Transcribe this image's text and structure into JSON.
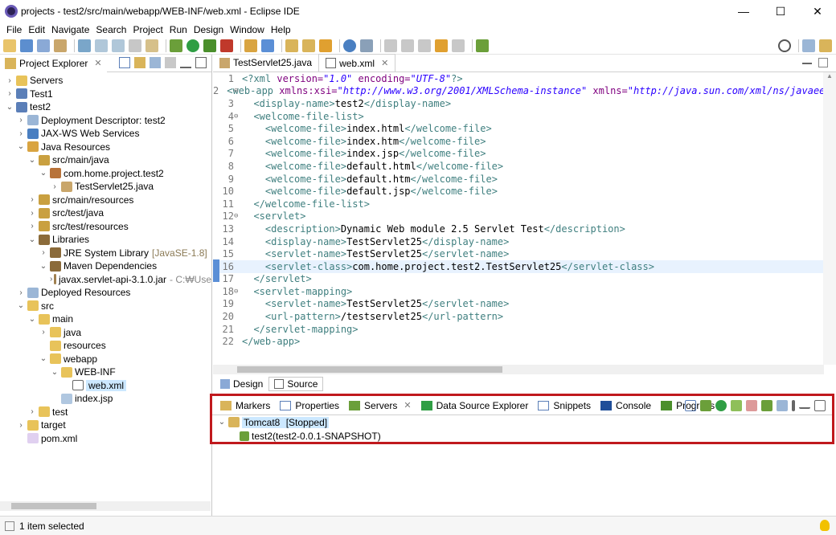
{
  "window": {
    "title": "projects - test2/src/main/webapp/WEB-INF/web.xml - Eclipse IDE",
    "minimize": "—",
    "maximize": "☐",
    "close": "✕"
  },
  "menu": [
    "File",
    "Edit",
    "Navigate",
    "Search",
    "Project",
    "Run",
    "Design",
    "Window",
    "Help"
  ],
  "project_explorer": {
    "tab_label": "Project Explorer",
    "tree": [
      {
        "indent": 0,
        "twisty": "›",
        "icon": "folder-icon",
        "label": "Servers"
      },
      {
        "indent": 0,
        "twisty": "›",
        "icon": "project-icon",
        "label": "Test1"
      },
      {
        "indent": 0,
        "twisty": "⌄",
        "icon": "project-icon",
        "label": "test2"
      },
      {
        "indent": 1,
        "twisty": "›",
        "icon": "deployment-descriptor-icon",
        "label": "Deployment Descriptor: test2"
      },
      {
        "indent": 1,
        "twisty": "›",
        "icon": "web-services-icon",
        "label": "JAX-WS Web Services"
      },
      {
        "indent": 1,
        "twisty": "⌄",
        "icon": "java-resources-icon",
        "label": "Java Resources"
      },
      {
        "indent": 2,
        "twisty": "⌄",
        "icon": "source-folder-icon",
        "label": "src/main/java"
      },
      {
        "indent": 3,
        "twisty": "⌄",
        "icon": "package-icon",
        "label": "com.home.project.test2"
      },
      {
        "indent": 4,
        "twisty": "›",
        "icon": "java-file-icon",
        "label": "TestServlet25.java"
      },
      {
        "indent": 2,
        "twisty": "›",
        "icon": "source-folder-icon",
        "label": "src/main/resources"
      },
      {
        "indent": 2,
        "twisty": "›",
        "icon": "source-folder-icon",
        "label": "src/test/java"
      },
      {
        "indent": 2,
        "twisty": "›",
        "icon": "source-folder-icon",
        "label": "src/test/resources"
      },
      {
        "indent": 2,
        "twisty": "⌄",
        "icon": "libraries-icon",
        "label": "Libraries"
      },
      {
        "indent": 3,
        "twisty": "›",
        "icon": "library-icon",
        "label": "JRE System Library",
        "suffix": "[JavaSE-1.8]"
      },
      {
        "indent": 3,
        "twisty": "⌄",
        "icon": "library-icon",
        "label": "Maven Dependencies"
      },
      {
        "indent": 4,
        "twisty": "›",
        "icon": "jar-icon",
        "label": "javax.servlet-api-3.1.0.jar",
        "suffix2": "- C:₩Use"
      },
      {
        "indent": 1,
        "twisty": "›",
        "icon": "deployed-resources-icon",
        "label": "Deployed Resources"
      },
      {
        "indent": 1,
        "twisty": "⌄",
        "icon": "folder-icon",
        "label": "src"
      },
      {
        "indent": 2,
        "twisty": "⌄",
        "icon": "folder-icon",
        "label": "main"
      },
      {
        "indent": 3,
        "twisty": "›",
        "icon": "folder-icon",
        "label": "java"
      },
      {
        "indent": 3,
        "twisty": "",
        "icon": "folder-icon",
        "label": "resources"
      },
      {
        "indent": 3,
        "twisty": "⌄",
        "icon": "folder-icon",
        "label": "webapp"
      },
      {
        "indent": 4,
        "twisty": "⌄",
        "icon": "folder-icon",
        "label": "WEB-INF"
      },
      {
        "indent": 5,
        "twisty": "",
        "icon": "xml-file-icon",
        "label": "web.xml",
        "selected": true
      },
      {
        "indent": 4,
        "twisty": "",
        "icon": "jsp-file-icon",
        "label": "index.jsp"
      },
      {
        "indent": 2,
        "twisty": "›",
        "icon": "folder-icon",
        "label": "test"
      },
      {
        "indent": 1,
        "twisty": "›",
        "icon": "folder-icon",
        "label": "target"
      },
      {
        "indent": 1,
        "twisty": "",
        "icon": "pom-file-icon",
        "label": "pom.xml"
      }
    ]
  },
  "editor": {
    "tabs": [
      {
        "label": "TestServlet25.java",
        "icon": "java-file-icon",
        "active": false
      },
      {
        "label": "web.xml",
        "icon": "xml-file-icon",
        "active": true
      }
    ],
    "lines": [
      {
        "n": "1",
        "fold": "",
        "parts": [
          [
            "pi",
            "<?xml "
          ],
          [
            "attr",
            "version="
          ],
          [
            "str",
            "\"1.0\""
          ],
          [
            "attr",
            " encoding="
          ],
          [
            "str",
            "\"UTF-8\""
          ],
          [
            "pi",
            "?>"
          ]
        ]
      },
      {
        "n": "2",
        "fold": "⊖",
        "parts": [
          [
            "tag",
            "<web-app "
          ],
          [
            "attr",
            "xmlns:xsi="
          ],
          [
            "str",
            "\"http://www.w3.org/2001/XMLSchema-instance\""
          ],
          [
            "attr",
            " xmlns="
          ],
          [
            "str",
            "\"http://java.sun.com/xml/ns/javaee\""
          ]
        ]
      },
      {
        "n": "3",
        "fold": "",
        "parts": [
          [
            "txt",
            "  "
          ],
          [
            "tag",
            "<display-name>"
          ],
          [
            "txt",
            "test2"
          ],
          [
            "tag",
            "</display-name>"
          ]
        ]
      },
      {
        "n": "4",
        "fold": "⊖",
        "parts": [
          [
            "txt",
            "  "
          ],
          [
            "tag",
            "<welcome-file-list>"
          ]
        ]
      },
      {
        "n": "5",
        "fold": "",
        "parts": [
          [
            "txt",
            "    "
          ],
          [
            "tag",
            "<welcome-file>"
          ],
          [
            "txt",
            "index.html"
          ],
          [
            "tag",
            "</welcome-file>"
          ]
        ]
      },
      {
        "n": "6",
        "fold": "",
        "parts": [
          [
            "txt",
            "    "
          ],
          [
            "tag",
            "<welcome-file>"
          ],
          [
            "txt",
            "index.htm"
          ],
          [
            "tag",
            "</welcome-file>"
          ]
        ]
      },
      {
        "n": "7",
        "fold": "",
        "parts": [
          [
            "txt",
            "    "
          ],
          [
            "tag",
            "<welcome-file>"
          ],
          [
            "txt",
            "index.jsp"
          ],
          [
            "tag",
            "</welcome-file>"
          ]
        ]
      },
      {
        "n": "8",
        "fold": "",
        "parts": [
          [
            "txt",
            "    "
          ],
          [
            "tag",
            "<welcome-file>"
          ],
          [
            "txt",
            "default.html"
          ],
          [
            "tag",
            "</welcome-file>"
          ]
        ]
      },
      {
        "n": "9",
        "fold": "",
        "parts": [
          [
            "txt",
            "    "
          ],
          [
            "tag",
            "<welcome-file>"
          ],
          [
            "txt",
            "default.htm"
          ],
          [
            "tag",
            "</welcome-file>"
          ]
        ]
      },
      {
        "n": "10",
        "fold": "",
        "parts": [
          [
            "txt",
            "    "
          ],
          [
            "tag",
            "<welcome-file>"
          ],
          [
            "txt",
            "default.jsp"
          ],
          [
            "tag",
            "</welcome-file>"
          ]
        ]
      },
      {
        "n": "11",
        "fold": "",
        "parts": [
          [
            "txt",
            "  "
          ],
          [
            "tag",
            "</welcome-file-list>"
          ]
        ]
      },
      {
        "n": "12",
        "fold": "⊖",
        "parts": [
          [
            "txt",
            "  "
          ],
          [
            "tag",
            "<servlet>"
          ]
        ]
      },
      {
        "n": "13",
        "fold": "",
        "parts": [
          [
            "txt",
            "    "
          ],
          [
            "tag",
            "<description>"
          ],
          [
            "txt",
            "Dynamic Web module 2.5 Servlet Test"
          ],
          [
            "tag",
            "</description>"
          ]
        ]
      },
      {
        "n": "14",
        "fold": "",
        "parts": [
          [
            "txt",
            "    "
          ],
          [
            "tag",
            "<display-name>"
          ],
          [
            "txt",
            "TestServlet25"
          ],
          [
            "tag",
            "</display-name>"
          ]
        ]
      },
      {
        "n": "15",
        "fold": "",
        "parts": [
          [
            "txt",
            "    "
          ],
          [
            "tag",
            "<servlet-name>"
          ],
          [
            "txt",
            "TestServlet25"
          ],
          [
            "tag",
            "</servlet-name>"
          ]
        ]
      },
      {
        "n": "16",
        "fold": "",
        "highlight": true,
        "parts": [
          [
            "txt",
            "    "
          ],
          [
            "tag",
            "<servlet-class>"
          ],
          [
            "txt",
            "com.home.project.test2.TestServlet25"
          ],
          [
            "tag",
            "</servlet-class>"
          ]
        ]
      },
      {
        "n": "17",
        "fold": "",
        "parts": [
          [
            "txt",
            "  "
          ],
          [
            "tag",
            "</servlet>"
          ]
        ]
      },
      {
        "n": "18",
        "fold": "⊖",
        "parts": [
          [
            "txt",
            "  "
          ],
          [
            "tag",
            "<servlet-mapping>"
          ]
        ]
      },
      {
        "n": "19",
        "fold": "",
        "parts": [
          [
            "txt",
            "    "
          ],
          [
            "tag",
            "<servlet-name>"
          ],
          [
            "txt",
            "TestServlet25"
          ],
          [
            "tag",
            "</servlet-name>"
          ]
        ]
      },
      {
        "n": "20",
        "fold": "",
        "parts": [
          [
            "txt",
            "    "
          ],
          [
            "tag",
            "<url-pattern>"
          ],
          [
            "txt",
            "/testservlet25"
          ],
          [
            "tag",
            "</url-pattern>"
          ]
        ]
      },
      {
        "n": "21",
        "fold": "",
        "parts": [
          [
            "txt",
            "  "
          ],
          [
            "tag",
            "</servlet-mapping>"
          ]
        ]
      },
      {
        "n": "22",
        "fold": "",
        "parts": [
          [
            "tag",
            "</web-app>"
          ]
        ]
      }
    ],
    "design_tab": "Design",
    "source_tab": "Source"
  },
  "servers_panel": {
    "tabs": [
      {
        "label": "Markers",
        "icon": "markers-icon"
      },
      {
        "label": "Properties",
        "icon": "properties-icon"
      },
      {
        "label": "Servers",
        "icon": "servers-icon",
        "active": true
      },
      {
        "label": "Data Source Explorer",
        "icon": "data-source-icon"
      },
      {
        "label": "Snippets",
        "icon": "snippets-icon"
      },
      {
        "label": "Console",
        "icon": "console-icon"
      },
      {
        "label": "Progress",
        "icon": "progress-icon"
      }
    ],
    "server_name": "Tomcat8",
    "server_state": "[Stopped]",
    "module": "test2(test2-0.0.1-SNAPSHOT)"
  },
  "status": {
    "text": "1 item selected"
  },
  "colors": {
    "highlight_border": "#c0191d",
    "selection": "#cce8ff",
    "xml_tag": "#3f7f7f",
    "xml_attr": "#7f007f",
    "xml_string": "#2a00ff"
  }
}
